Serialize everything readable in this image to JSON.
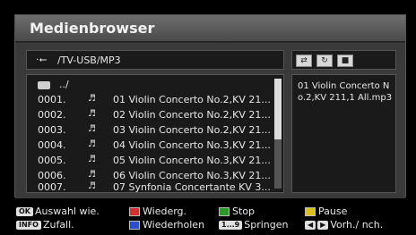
{
  "window": {
    "title": "Medienbrowser"
  },
  "path": {
    "icon": "usb-icon",
    "text": "/TV-USB/MP3"
  },
  "toolbar_icons": [
    "shuffle-icon",
    "repeat-icon",
    "stop-icon"
  ],
  "list": {
    "parent": "../",
    "items": [
      {
        "num": "0001.",
        "name": "01 Violin Concerto No.2,KV 21..."
      },
      {
        "num": "0002.",
        "name": "02 Violin Concerto No.2,KV 21..."
      },
      {
        "num": "0003.",
        "name": "03 Violin Concerto No.2,KV 21..."
      },
      {
        "num": "0004.",
        "name": "04 Violin Concerto No.3,KV 21..."
      },
      {
        "num": "0005.",
        "name": "05 Violin Concerto No.3,KV 21..."
      },
      {
        "num": "0006.",
        "name": "06 Violin Concerto No.3,KV 21..."
      },
      {
        "num": "0007.",
        "name": "07 Synfonia Concertante KV 3..."
      }
    ]
  },
  "info": {
    "text": "01 Violin Concerto No.2,KV 211,1 All.mp3"
  },
  "footer": {
    "ok_key": "OK",
    "ok_label": "Auswahl wie.",
    "info_key": "INFO",
    "info_label": "Zufall.",
    "wiederg_label": "Wiederg.",
    "wiederholen_label": "Wiederholen",
    "stop_label": "Stop",
    "springen_key": "1...9",
    "springen_label": "Springen",
    "pause_label": "Pause",
    "nav_label": "Vorh./ nch.",
    "swatch_colors": {
      "red": "#d23030",
      "green": "#2a9a2a",
      "blue": "#2a4fc8",
      "yellow": "#d8c020"
    }
  }
}
